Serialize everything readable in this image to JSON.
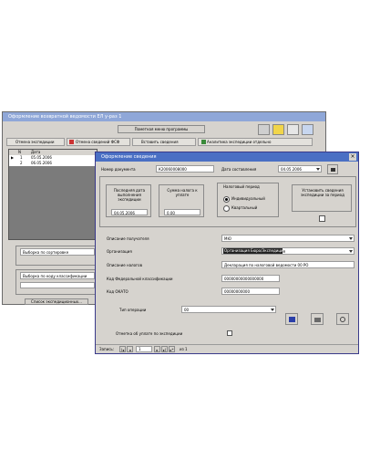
{
  "back_window": {
    "title": "Оформление возвратной ведомости ЕЛ у-раз 1",
    "toolbar_button": "Пометная меню программы",
    "tabs": [
      "Отмена экспедиции",
      "Отмена сведений ФСФ",
      "Вставить сведения",
      "Аналитика экспедиции отдельно"
    ],
    "grid_headers": [
      "N",
      "Дата"
    ],
    "grid_rows": [
      {
        "marker": "▶",
        "n": "1",
        "date": "05.05.2006"
      },
      {
        "marker": "",
        "n": "2",
        "date": "06.05.2006"
      }
    ],
    "panel1_label": "Выборка по сортировке",
    "panel2_label": "Выборка по коду классификации",
    "bottom_button": "Список экспедиционных..."
  },
  "front_window": {
    "title": "Оформление сведения",
    "doc_number_label": "Номер документа",
    "doc_number_value": "К20060008000",
    "date_label": "Дата составления",
    "date_value": "04.05.2006",
    "box1_label": "Последняя дата выполнения экспедиции",
    "box1_value": "04.05.2006",
    "box2_label": "Сумма налога к уплате",
    "box2_value": "0.00",
    "period_group_label": "Налоговый период",
    "radio1": "Индивидуальный",
    "radio2": "Квартальный",
    "box3_label": "Установить сведения экспедиции за период",
    "rows": [
      {
        "label": "Описание получателя",
        "value": "МЮ"
      },
      {
        "label": "Организация",
        "value": "Организация Бюро/Экспедиция"
      },
      {
        "label": "Описание налогов",
        "value": "Декларация по налоговой ведомости 00 РО"
      },
      {
        "label": "Код Федеральной классификации",
        "value": "00000000000000000"
      },
      {
        "label": "Код ОКАТО",
        "value": "00000000000"
      },
      {
        "label": "Тип операции",
        "value": "00"
      }
    ],
    "checkbox_label": "Отметка об уплате по экспедиции",
    "status_label": "Запись:",
    "record_number": "1",
    "record_total": "из 1"
  }
}
